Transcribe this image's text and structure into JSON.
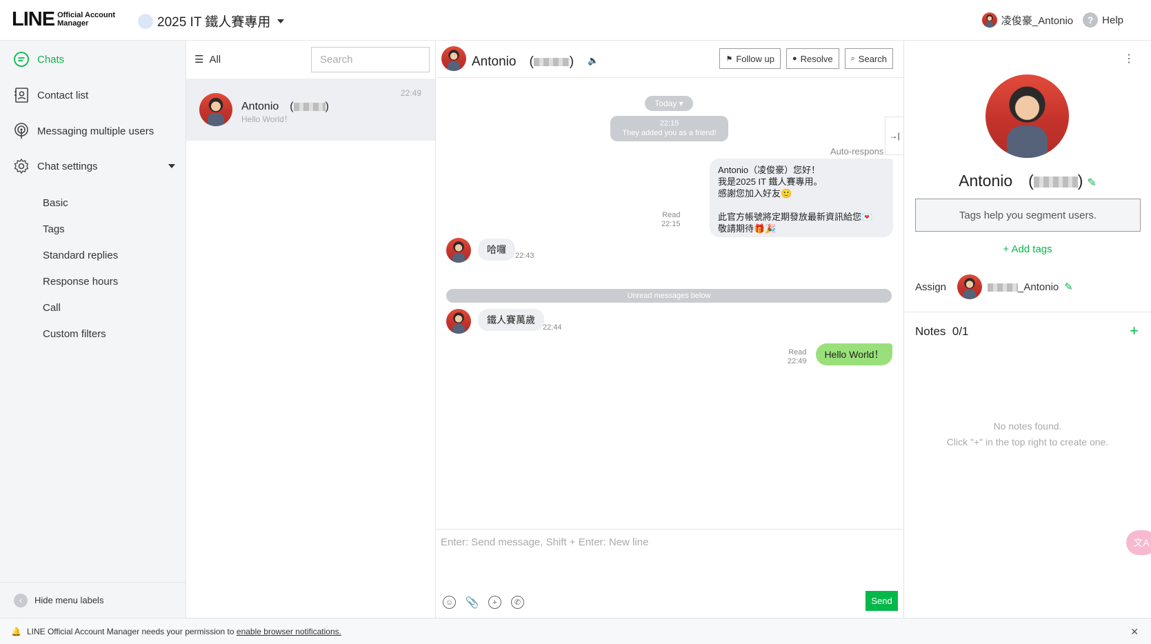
{
  "header": {
    "logo_text": "LINE",
    "logo_sub1": "Official Account",
    "logo_sub2": "Manager",
    "account_name": "2025 IT 鐵人賽專用",
    "user_name": "凌俊豪_Antonio",
    "help_label": "Help"
  },
  "sidebar": {
    "items": [
      {
        "label": "Chats",
        "icon": "chat-bubble-icon"
      },
      {
        "label": "Contact list",
        "icon": "contact-card-icon"
      },
      {
        "label": "Messaging multiple users",
        "icon": "broadcast-icon"
      },
      {
        "label": "Chat settings",
        "icon": "gear-icon"
      }
    ],
    "sub_items": [
      "Basic",
      "Tags",
      "Standard replies",
      "Response hours",
      "Call",
      "Custom filters"
    ],
    "footer_label": "Hide menu labels"
  },
  "chat_list": {
    "filter_label": "All",
    "search_placeholder": "Search",
    "items": [
      {
        "name": "Antonio　(",
        "name_end": ")",
        "preview": "Hello World！",
        "time": "22:49"
      }
    ]
  },
  "chat": {
    "title": "Antonio　(",
    "title_end": ")",
    "buttons": {
      "follow_up": "Follow up",
      "resolve": "Resolve",
      "search": "Search"
    },
    "date_chip": "Today",
    "system_time": "22:15",
    "system_text": "They added you as a friend!",
    "auto_label": "Auto-respons",
    "auto_text": "Antonio（凌俊豪）您好！\n我是2025 IT 鐵人賽專用。\n感謝您加入好友🙂\n\n此官方帳號將定期發放最新資訊給您💌\n敬請期待🎁🎉",
    "auto_read": "Read",
    "auto_time": "22:15",
    "msg1_text": "哈囉",
    "msg1_time": "22:43",
    "unread_label": "Unread messages below",
    "msg2_text": "鐵人賽萬歲",
    "msg2_time": "22:44",
    "out_read": "Read",
    "out_time": "22:49",
    "out_text": "Hello World！",
    "composer_placeholder": "Enter: Send message, Shift + Enter: New line",
    "send_label": "Send"
  },
  "profile": {
    "name": "Antonio　(",
    "name_end": ")",
    "tags_hint": "Tags help you segment users.",
    "add_tags": "+ Add tags",
    "assign_label": "Assign",
    "assignee": "_Antonio",
    "notes_title": "Notes",
    "notes_count": "0/1",
    "notes_empty1": "No notes found.",
    "notes_empty2": "Click \"+\" in the top right to create one."
  },
  "banner": {
    "text": "LINE Official Account Manager needs your permission to",
    "link": "enable browser notifications."
  },
  "colors": {
    "accent": "#06b84a",
    "outgoing_bubble": "#9ae07a",
    "system_chip": "#c9ccd0"
  }
}
